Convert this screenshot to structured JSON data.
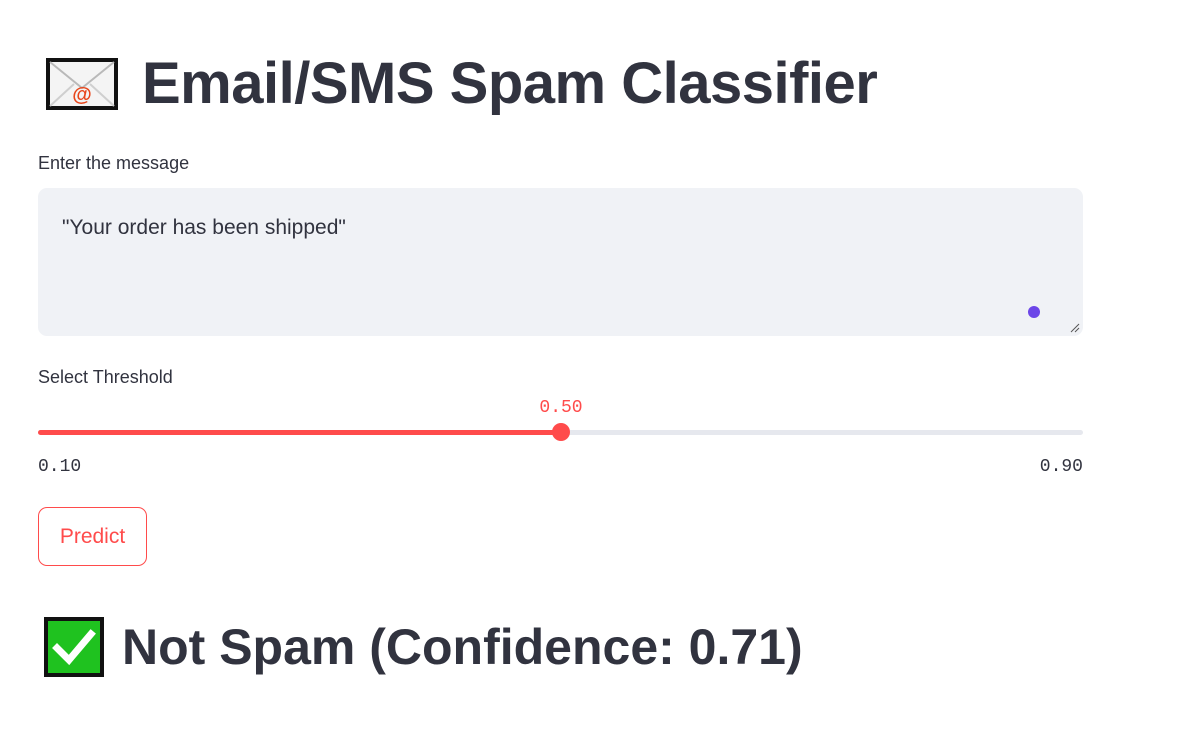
{
  "header": {
    "title": "Email/SMS Spam Classifier",
    "icon": "envelope-with-at-icon"
  },
  "message_input": {
    "label": "Enter the message",
    "value": "\"Your order has been shipped\""
  },
  "threshold_slider": {
    "label": "Select Threshold",
    "value": 0.5,
    "value_text": "0.50",
    "min": 0.1,
    "min_text": "0.10",
    "max": 0.9,
    "max_text": "0.90"
  },
  "predict_button": {
    "label": "Predict"
  },
  "result": {
    "icon": "green-check-icon",
    "text": "Not Spam (Confidence: 0.71)"
  },
  "colors": {
    "accent": "#ff4b4b",
    "text": "#31333f",
    "input_bg": "#f0f2f6",
    "track": "#e6e8ee",
    "check_green": "#1fc21f",
    "focus_dot": "#6c46e8"
  }
}
